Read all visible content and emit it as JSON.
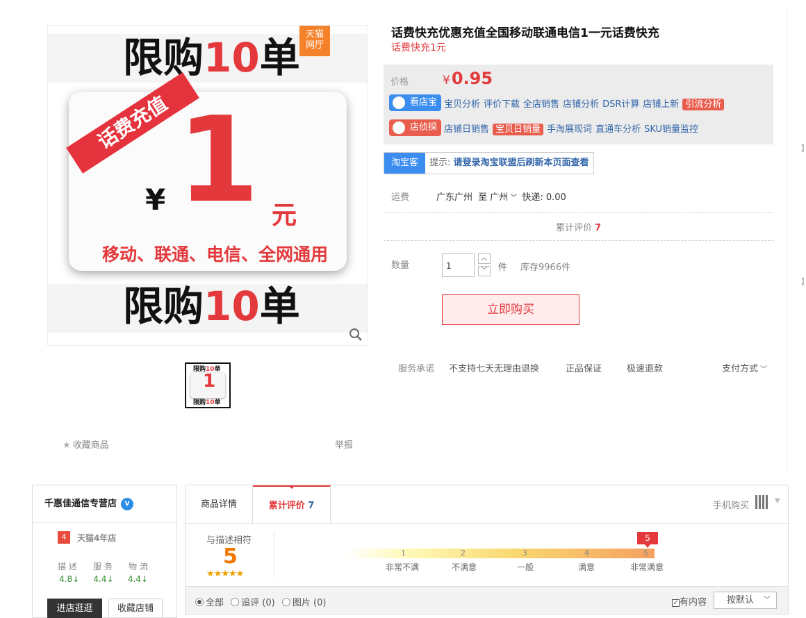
{
  "product": {
    "title": "话费快充优惠充值全国移动联通电信1一元话费快充",
    "subtitle": "话费快充1元"
  },
  "image": {
    "top_text_a": "限购",
    "top_text_num": "10",
    "top_text_b": "单",
    "tmall_line1": "天猫",
    "tmall_line2": "网厅",
    "ribbon": "话费充值",
    "currency": "¥",
    "amount": "1",
    "unit": "元",
    "carriers": "移动、联通、电信、全网通用",
    "bottom_text_a": "限购",
    "bottom_text_num": "10",
    "bottom_text_b": "单"
  },
  "actions": {
    "favorite": "收藏商品",
    "report": "举报"
  },
  "price": {
    "label": "价格",
    "symbol": "¥",
    "value": "0.95"
  },
  "tools": {
    "row1_badge": "看店宝",
    "row1_links": [
      "宝贝分析",
      "评价下载",
      "全店销售",
      "店铺分析",
      "DSR计算",
      "店铺上新"
    ],
    "row1_highlight": "引流分析",
    "row2_badge": "店侦探",
    "row2_link_a": "店铺日销售",
    "row2_highlight": "宝贝日销量",
    "row2_links": [
      "手淘展现词",
      "直通车分析",
      "SKU销量监控"
    ]
  },
  "taobaoke": {
    "tag": "淘宝客",
    "hint_prefix": "提示: ",
    "hint": "请登录淘宝联盟后刷新本页面查看"
  },
  "shipping": {
    "label": "运费",
    "from": "广东广州",
    "to_word": "至",
    "to": "广州",
    "method": "快递: 0.00"
  },
  "reviews_line": {
    "label": "累计评价",
    "count": "7"
  },
  "quantity": {
    "label": "数量",
    "value": "1",
    "unit": "件",
    "stock": "库存9966件"
  },
  "buy_label": "立即购买",
  "service": {
    "label": "服务承诺",
    "items": [
      "不支持七天无理由退换",
      "正品保证",
      "极速退款"
    ],
    "payment": "支付方式"
  },
  "shop": {
    "name": "千惠佳通信专营店",
    "years_badge": "4",
    "years_text": "天猫4年店",
    "metrics": [
      {
        "label": "描 述",
        "value": "4.8"
      },
      {
        "label": "服 务",
        "value": "4.4"
      },
      {
        "label": "物 流",
        "value": "4.4"
      }
    ],
    "enter": "进店逛逛",
    "fav": "收藏店铺"
  },
  "tabs": {
    "detail": "商品详情",
    "reviews": "累计评价",
    "reviews_count": "7",
    "mobile": "手机购买"
  },
  "rating": {
    "label": "与描述相符",
    "score": "5",
    "stars": 5,
    "marker": "5",
    "scale_nums": [
      "1",
      "2",
      "3",
      "4",
      "5"
    ],
    "scale_labels": [
      "非常不满",
      "不满意",
      "一般",
      "满意",
      "非常满意"
    ]
  },
  "filter": {
    "all": "全部",
    "append": "追评 (0)",
    "photo": "图片 (0)",
    "has_content": "有内容",
    "sort": "按默认"
  },
  "colors": {
    "accent": "#e4393c",
    "link": "#3366aa",
    "kandianbao": "#3b8df0",
    "dianzhentan": "#e85d4d",
    "up_green": "#2e8b2e"
  }
}
